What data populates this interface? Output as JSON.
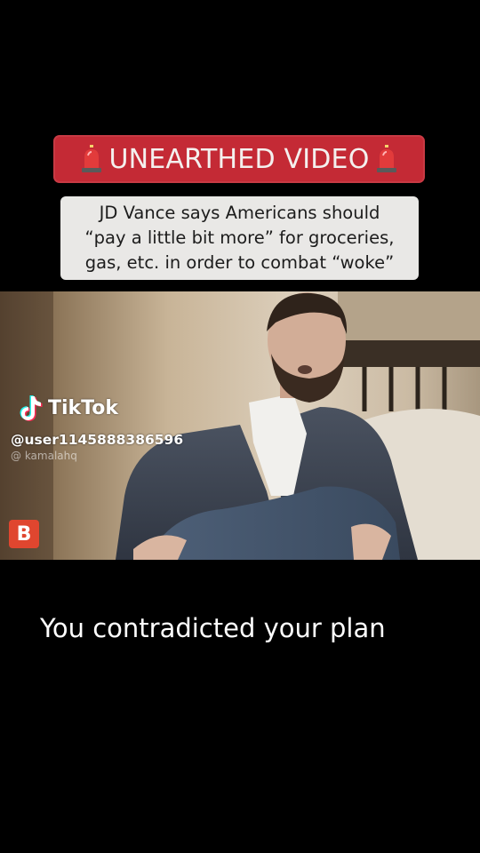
{
  "banner": {
    "text": "UNEARTHED VIDEO",
    "left_icon": "police-siren-icon",
    "right_icon": "police-siren-icon",
    "color": "#c42a35"
  },
  "headline": {
    "lines": [
      "JD Vance says Americans should",
      "“pay a little bit more” for groceries,",
      "gas, etc. in order to combat “woke”"
    ]
  },
  "watermark": {
    "brand": "TikTok",
    "username": "@user1145888386596",
    "source_handle": "@ kamalahq"
  },
  "video": {
    "channel_logo_letter": "B",
    "channel_logo_color": "#e0462f"
  },
  "caption": {
    "text": "You contradicted your plan"
  }
}
